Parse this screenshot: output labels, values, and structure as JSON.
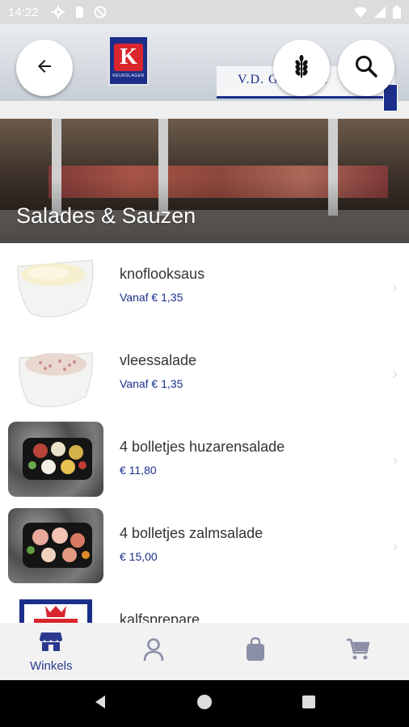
{
  "status_bar": {
    "time": "14:22",
    "left_icons": [
      "gear-icon",
      "sim-card-icon",
      "no-data-icon"
    ],
    "right_icons": [
      "wifi-icon",
      "signal-icon",
      "battery-icon"
    ]
  },
  "header": {
    "title": "Salades & Sauzen",
    "buttons": [
      "back-arrow-icon",
      "wheat-icon",
      "search-icon"
    ],
    "store_sign_text": "V.D. G           aardage"
  },
  "products": [
    {
      "name": "knoflooksaus",
      "price": "Vanaf € 1,35",
      "image": "sauce-bowl"
    },
    {
      "name": "vleessalade",
      "price": "Vanaf € 1,35",
      "image": "salad-bowl"
    },
    {
      "name": "4 bolletjes huzarensalade",
      "price": "€ 11,80",
      "image": "huzarensalade-tray"
    },
    {
      "name": "4 bolletjes zalmsalade",
      "price": "€ 15,00",
      "image": "zalmsalade-tray"
    },
    {
      "name": "kalfsprepare",
      "price": "",
      "image": "logo"
    }
  ],
  "bottom_nav": {
    "items": [
      {
        "icon": "store-icon",
        "label": "Winkels",
        "active": true
      },
      {
        "icon": "person-icon",
        "label": "",
        "active": false
      },
      {
        "icon": "shopping-bag-icon",
        "label": "",
        "active": false
      },
      {
        "icon": "cart-icon",
        "label": "",
        "active": false
      }
    ]
  },
  "colors": {
    "accent": "#2b3a8f",
    "price": "#1b2f8a",
    "nav_inactive": "#8a8fa6",
    "logo_red": "#d9262c"
  }
}
